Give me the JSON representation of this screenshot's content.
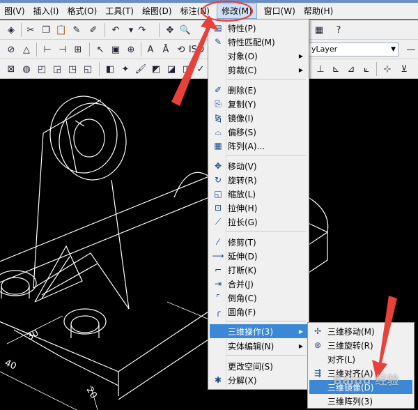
{
  "menubar": {
    "items": [
      "图(V)",
      "插入(I)",
      "格式(O)",
      "工具(T)",
      "绘图(D)",
      "标注(N)",
      "修改(M)",
      "窗口(W)",
      "帮助(H)"
    ],
    "active": "修改(M)"
  },
  "toolbar": {
    "iso_label": "ISO",
    "layer_value": "yLayer"
  },
  "modify_menu": {
    "items": [
      {
        "label": "特性(P)",
        "icon": "properties-icon"
      },
      {
        "label": "特性匹配(M)",
        "icon": "match-properties-icon"
      },
      {
        "label": "对象(O)",
        "submenu": true
      },
      {
        "label": "剪裁(C)",
        "submenu": true
      },
      {
        "label": "删除(E)",
        "icon": "erase-icon"
      },
      {
        "label": "复制(Y)",
        "icon": "copy-icon"
      },
      {
        "label": "镜像(I)",
        "icon": "mirror-icon"
      },
      {
        "label": "偏移(S)",
        "icon": "offset-icon"
      },
      {
        "label": "阵列(A)...",
        "icon": "array-icon"
      },
      {
        "label": "移动(V)",
        "icon": "move-icon"
      },
      {
        "label": "旋转(R)",
        "icon": "rotate-icon"
      },
      {
        "label": "缩放(L)",
        "icon": "scale-icon"
      },
      {
        "label": "拉伸(H)",
        "icon": "stretch-icon"
      },
      {
        "label": "拉长(G)",
        "icon": "lengthen-icon"
      },
      {
        "label": "修剪(T)",
        "icon": "trim-icon"
      },
      {
        "label": "延伸(D)",
        "icon": "extend-icon"
      },
      {
        "label": "打断(K)",
        "icon": "break-icon"
      },
      {
        "label": "合并(J)",
        "icon": "join-icon"
      },
      {
        "label": "倒角(C)",
        "icon": "chamfer-icon"
      },
      {
        "label": "圆角(F)",
        "icon": "fillet-icon"
      },
      {
        "label": "三维操作(3)",
        "submenu": true,
        "highlighted": true
      },
      {
        "label": "实体编辑(N)",
        "submenu": true
      },
      {
        "label": "更改空间(S)"
      },
      {
        "label": "分解(X)",
        "icon": "explode-icon"
      }
    ]
  },
  "threed_submenu": {
    "items": [
      {
        "label": "三维移动(M)",
        "icon": "3d-move-icon"
      },
      {
        "label": "三维旋转(R)",
        "icon": "3d-rotate-icon"
      },
      {
        "label": "对齐(L)"
      },
      {
        "label": "三维对齐(A)",
        "icon": "3d-align-icon"
      },
      {
        "label": "三维镜像(D)",
        "highlighted": true
      },
      {
        "label": "三维阵列(3)"
      }
    ]
  },
  "watermark": {
    "text": "Baidu 经验"
  },
  "drawing_dims": {
    "a": "30",
    "b": "20",
    "c": "40"
  },
  "colors": {
    "menu_bg": "#f0f0f0",
    "highlight": "#3d88d6",
    "annotation_red": "#e8413a",
    "canvas_bg": "#000000"
  }
}
